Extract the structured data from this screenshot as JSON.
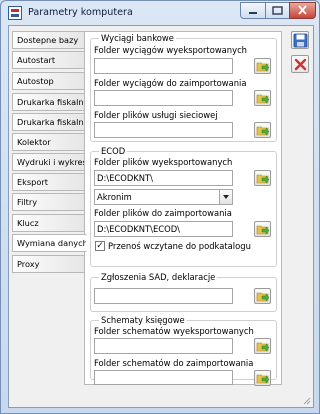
{
  "window": {
    "title": "Parametry komputera",
    "icon": "app-icon",
    "controls": [
      "minimize",
      "maximize",
      "close"
    ]
  },
  "tabs": [
    "Dostepne bazy",
    "Autostart",
    "Autostop",
    "Drukarka fiskalna",
    "Drukarka fiskalna 2",
    "Kolektor",
    "Wydruki i wykresy",
    "Eksport",
    "Filtry",
    "Klucz",
    "Wymiana danych",
    "Proxy"
  ],
  "active_tab": "Wymiana danych",
  "sections": {
    "wyciagi": {
      "title": "Wyciągi bankowe",
      "fields": [
        {
          "label": "Folder wyciągów wyeksportowanych",
          "value": ""
        },
        {
          "label": "Folder wyciągów do zaimportowania",
          "value": ""
        },
        {
          "label": "Folder plików usługi sieciowej",
          "value": ""
        }
      ]
    },
    "ecod": {
      "title": "ECOD",
      "export_label": "Folder plików wyeksportowanych",
      "export_value": "D:\\ECODKNT\\",
      "format_value": "Akronim",
      "import_label": "Folder plików do zaimportowania",
      "import_value": "D:\\ECODKNT\\ECOD\\",
      "checkbox_label": "Przenoś wczytane do podkatalogu",
      "checkbox_checked": true
    },
    "sad": {
      "title": "Zgłoszenia SAD, deklaracje",
      "value": ""
    },
    "schematy": {
      "title": "Schematy księgowe",
      "fields": [
        {
          "label": "Folder schematów wyeksportowanych",
          "value": ""
        },
        {
          "label": "Folder schematów do zaimportowania",
          "value": ""
        }
      ]
    }
  },
  "actions": {
    "save": "save-icon",
    "cancel": "cancel-icon"
  }
}
